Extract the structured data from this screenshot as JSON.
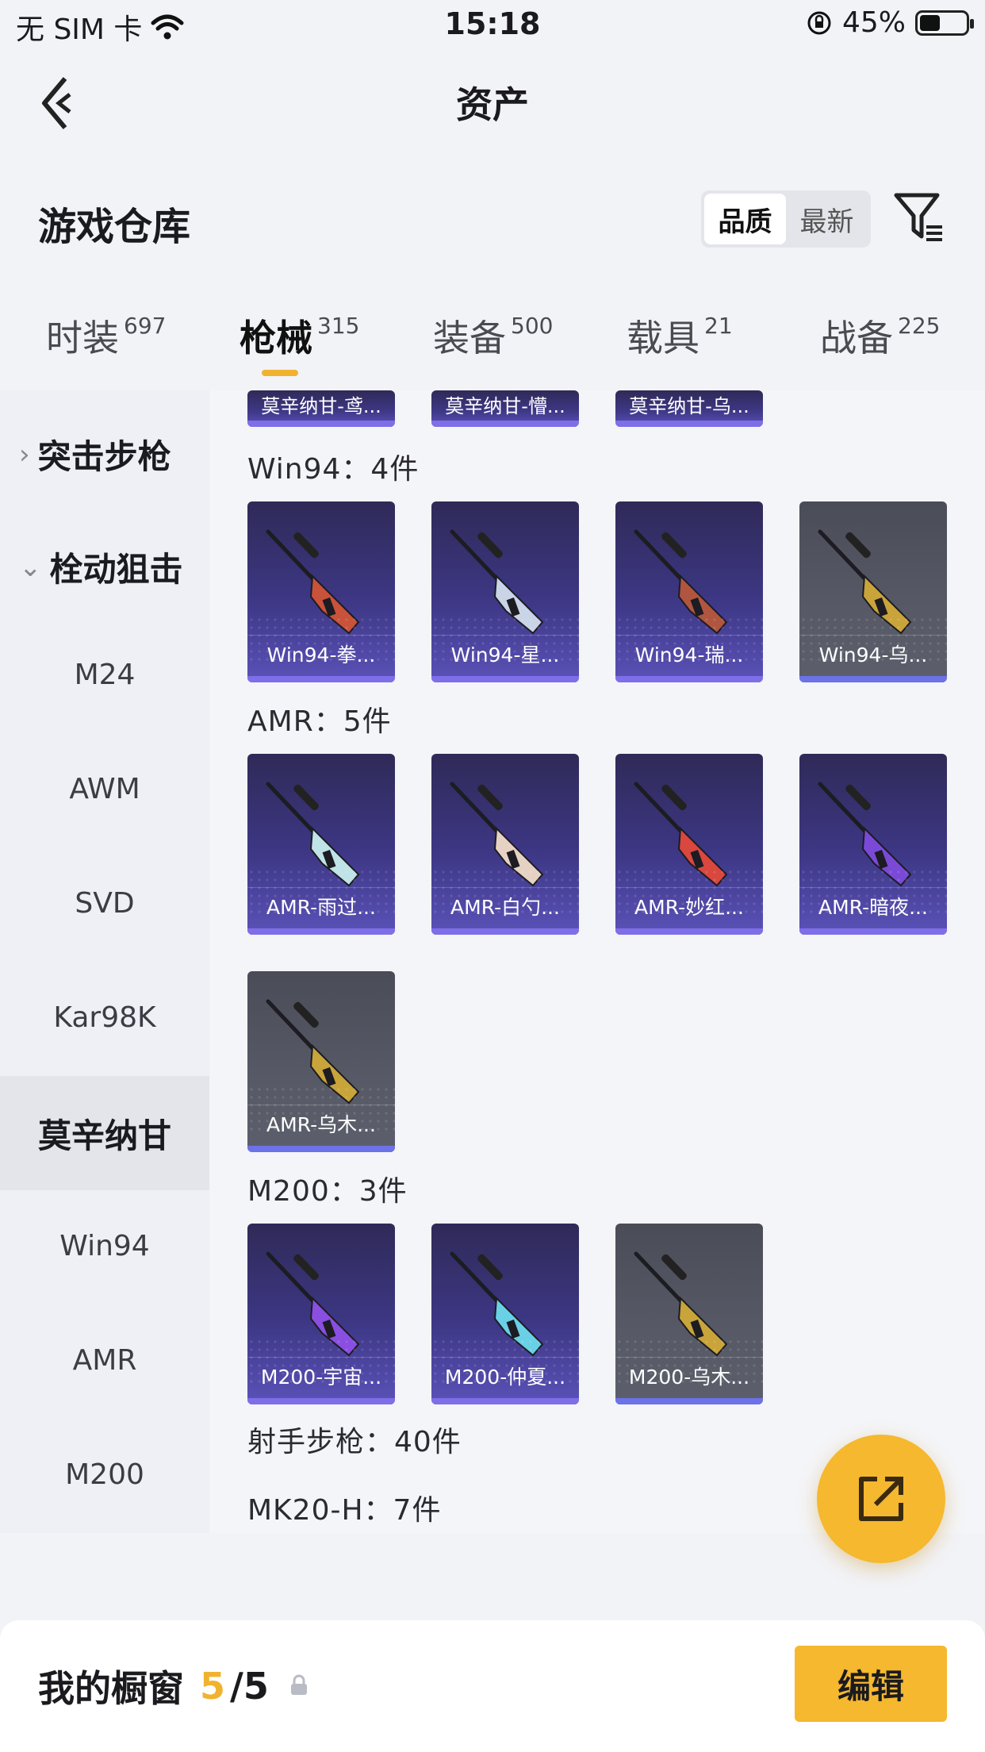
{
  "status_bar": {
    "carrier": "无 SIM 卡",
    "time": "15:18",
    "battery": "45%",
    "battery_level": 0.45
  },
  "nav": {
    "title": "资产"
  },
  "warehouse": {
    "title": "游戏仓库",
    "sort": {
      "options": [
        "品质",
        "最新"
      ],
      "selected": "品质"
    }
  },
  "tabs": [
    {
      "label": "时装",
      "count": "697"
    },
    {
      "label": "枪械",
      "count": "315"
    },
    {
      "label": "装备",
      "count": "500"
    },
    {
      "label": "载具",
      "count": "21"
    },
    {
      "label": "战备",
      "count": "225"
    }
  ],
  "active_tab": "枪械",
  "sidebar": {
    "groups": [
      {
        "label": "突击步枪"
      },
      {
        "label": "栓动狙击"
      }
    ],
    "items": [
      "M24",
      "AWM",
      "SVD",
      "Kar98K",
      "莫辛纳甘",
      "Win94",
      "AMR",
      "M200"
    ],
    "selected": "莫辛纳甘"
  },
  "content": {
    "partial_row": [
      "莫辛纳甘-鸢...",
      "莫辛纳甘-懵...",
      "莫辛纳甘-乌..."
    ],
    "groups": [
      {
        "label": "Win94：4件",
        "items": [
          {
            "name": "Win94-拳...",
            "quality": "purple",
            "body": "#c9523a"
          },
          {
            "name": "Win94-星...",
            "quality": "purple",
            "body": "#c9d4e6"
          },
          {
            "name": "Win94-瑞...",
            "quality": "purple",
            "body": "#b0553f"
          },
          {
            "name": "Win94-乌...",
            "quality": "grey",
            "body": "#c9a43a"
          }
        ]
      },
      {
        "label": "AMR：5件",
        "items": [
          {
            "name": "AMR-雨过...",
            "quality": "purple",
            "body": "#bfe3e6"
          },
          {
            "name": "AMR-白勺...",
            "quality": "purple",
            "body": "#e6d2c3"
          },
          {
            "name": "AMR-妙红...",
            "quality": "purple",
            "body": "#d9473f"
          },
          {
            "name": "AMR-暗夜...",
            "quality": "purple",
            "body": "#7a4ad6"
          },
          {
            "name": "AMR-乌木...",
            "quality": "grey",
            "body": "#c9a43a"
          }
        ]
      },
      {
        "label": "M200：3件",
        "items": [
          {
            "name": "M200-宇宙...",
            "quality": "purple",
            "body": "#8a4ee0"
          },
          {
            "name": "M200-仲夏...",
            "quality": "purple",
            "body": "#6ad0e6"
          },
          {
            "name": "M200-乌木...",
            "quality": "grey",
            "body": "#c9a43a"
          }
        ]
      }
    ],
    "more_groups": [
      "射手步枪：40件",
      "MK20-H：7件"
    ]
  },
  "bottom": {
    "title": "我的橱窗",
    "count_current": "5",
    "count_total": "/5",
    "edit_label": "编辑"
  },
  "colors": {
    "accent": "#f5b82e",
    "purple_card": "#3d3785",
    "grey_card": "#575a66"
  },
  "icons": [
    "wifi-icon",
    "rotation-lock-icon",
    "battery-icon",
    "back-arrow-icon",
    "filter-icon",
    "chevron-right-icon",
    "chevron-down-icon",
    "share-icon",
    "lock-icon"
  ]
}
